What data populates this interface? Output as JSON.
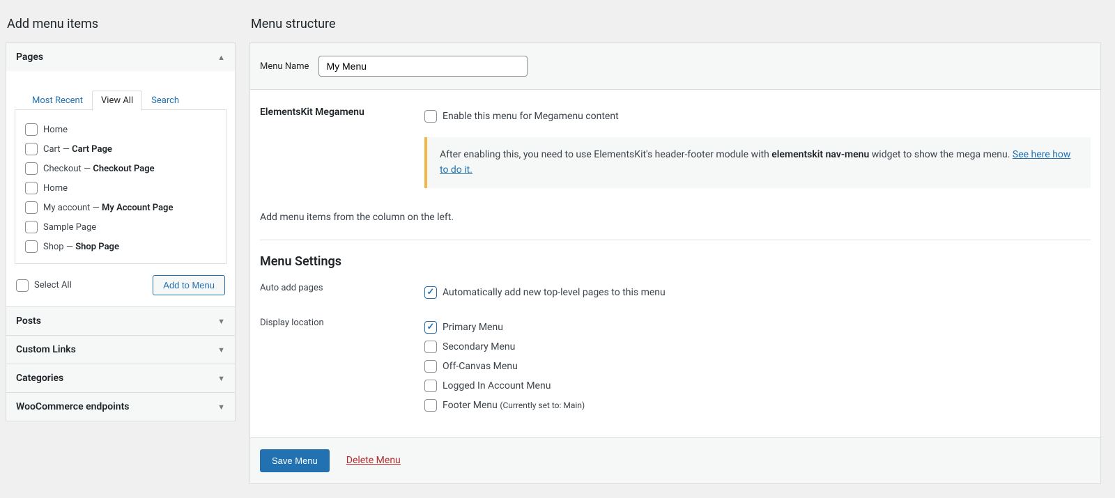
{
  "left": {
    "heading": "Add menu items",
    "panels": [
      {
        "title": "Pages",
        "open": true
      },
      {
        "title": "Posts",
        "open": false
      },
      {
        "title": "Custom Links",
        "open": false
      },
      {
        "title": "Categories",
        "open": false
      },
      {
        "title": "WooCommerce endpoints",
        "open": false
      }
    ],
    "tabs": {
      "most_recent": "Most Recent",
      "view_all": "View All",
      "search": "Search",
      "active": "view_all"
    },
    "page_items": [
      {
        "text": "Home",
        "bold": ""
      },
      {
        "text": "Cart — ",
        "bold": "Cart Page"
      },
      {
        "text": "Checkout — ",
        "bold": "Checkout Page"
      },
      {
        "text": "Home",
        "bold": ""
      },
      {
        "text": "My account — ",
        "bold": "My Account Page"
      },
      {
        "text": "Sample Page",
        "bold": ""
      },
      {
        "text": "Shop — ",
        "bold": "Shop Page"
      }
    ],
    "select_all_label": "Select All",
    "add_to_menu_label": "Add to Menu"
  },
  "right": {
    "heading": "Menu structure",
    "menu_name_label": "Menu Name",
    "menu_name_value": "My Menu",
    "megamenu_label": "ElementsKit Megamenu",
    "megamenu_checkbox_label": "Enable this menu for Megamenu content",
    "megamenu_note_pre": "After enabling this, you need to use ElementsKit's header-footer module with ",
    "megamenu_note_bold": "elementskit nav-menu",
    "megamenu_note_post": " widget to show the mega menu. ",
    "megamenu_note_link": "See here how to do it.",
    "instruction": "Add menu items from the column on the left.",
    "settings_heading": "Menu Settings",
    "auto_add_label": "Auto add pages",
    "auto_add_checkbox_label": "Automatically add new top-level pages to this menu",
    "auto_add_checked": true,
    "display_loc_label": "Display location",
    "locations": [
      {
        "label": "Primary Menu",
        "checked": true,
        "suffix": ""
      },
      {
        "label": "Secondary Menu",
        "checked": false,
        "suffix": ""
      },
      {
        "label": "Off-Canvas Menu",
        "checked": false,
        "suffix": ""
      },
      {
        "label": "Logged In Account Menu",
        "checked": false,
        "suffix": ""
      },
      {
        "label": "Footer Menu ",
        "checked": false,
        "suffix": "(Currently set to: Main)"
      }
    ],
    "save_label": "Save Menu",
    "delete_label": "Delete Menu"
  }
}
